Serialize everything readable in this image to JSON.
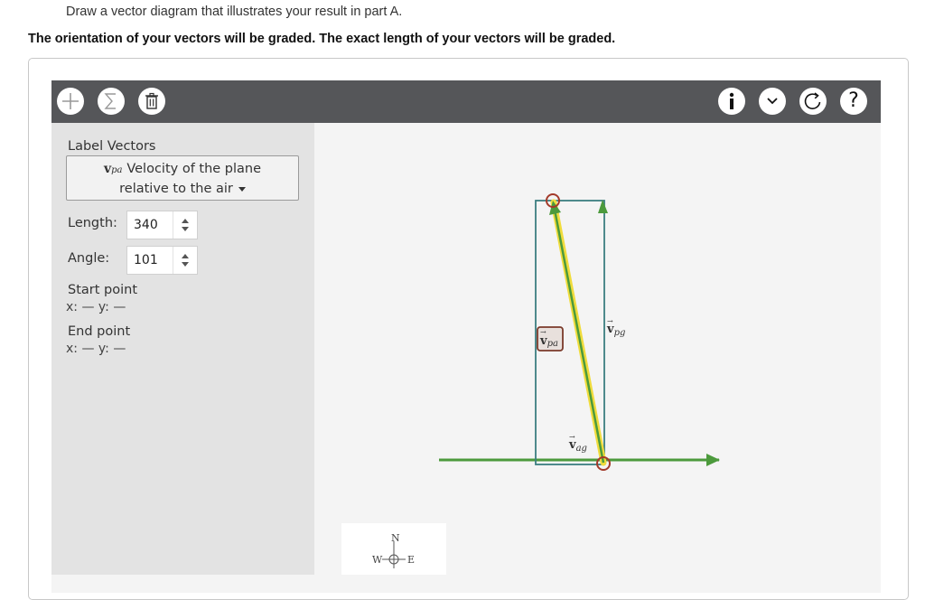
{
  "instruction": "Draw a vector diagram that illustrates your result in part A.",
  "grading_note": "The orientation of your vectors will be graded. The exact length of your vectors will be graded.",
  "toolbar": {
    "left_icons": [
      "plus-icon",
      "sigma-icon",
      "trash-icon"
    ],
    "right_icons": [
      "info-icon",
      "chevron-down-icon",
      "reset-icon",
      "help-icon"
    ],
    "help_glyph": "?"
  },
  "side_panel": {
    "label_vectors_title": "Label Vectors",
    "selected_vector_symbol": "v",
    "selected_vector_subscript": "pa",
    "selected_vector_desc_line1": "Velocity of the plane",
    "selected_vector_desc_line2": "relative to the air",
    "length_label": "Length:",
    "length_value": "340",
    "angle_label": "Angle:",
    "angle_value": "101",
    "start_point_label": "Start point",
    "start_point_coords": "x: — y: —",
    "end_point_label": "End point",
    "end_point_coords": "x: — y: —"
  },
  "diagram": {
    "vector_labels": [
      {
        "symbol": "v",
        "subscript": "pa"
      },
      {
        "symbol": "v",
        "subscript": "pg"
      },
      {
        "symbol": "v",
        "subscript": "ag"
      }
    ],
    "colors": {
      "green": "#4c9a3c",
      "yellow": "#f0dc3c",
      "teal_box": "#3c7f80",
      "handle": "#a33a2a",
      "toolbar": "#555659"
    }
  },
  "compass": {
    "n": "N",
    "w": "W",
    "e": "E"
  }
}
